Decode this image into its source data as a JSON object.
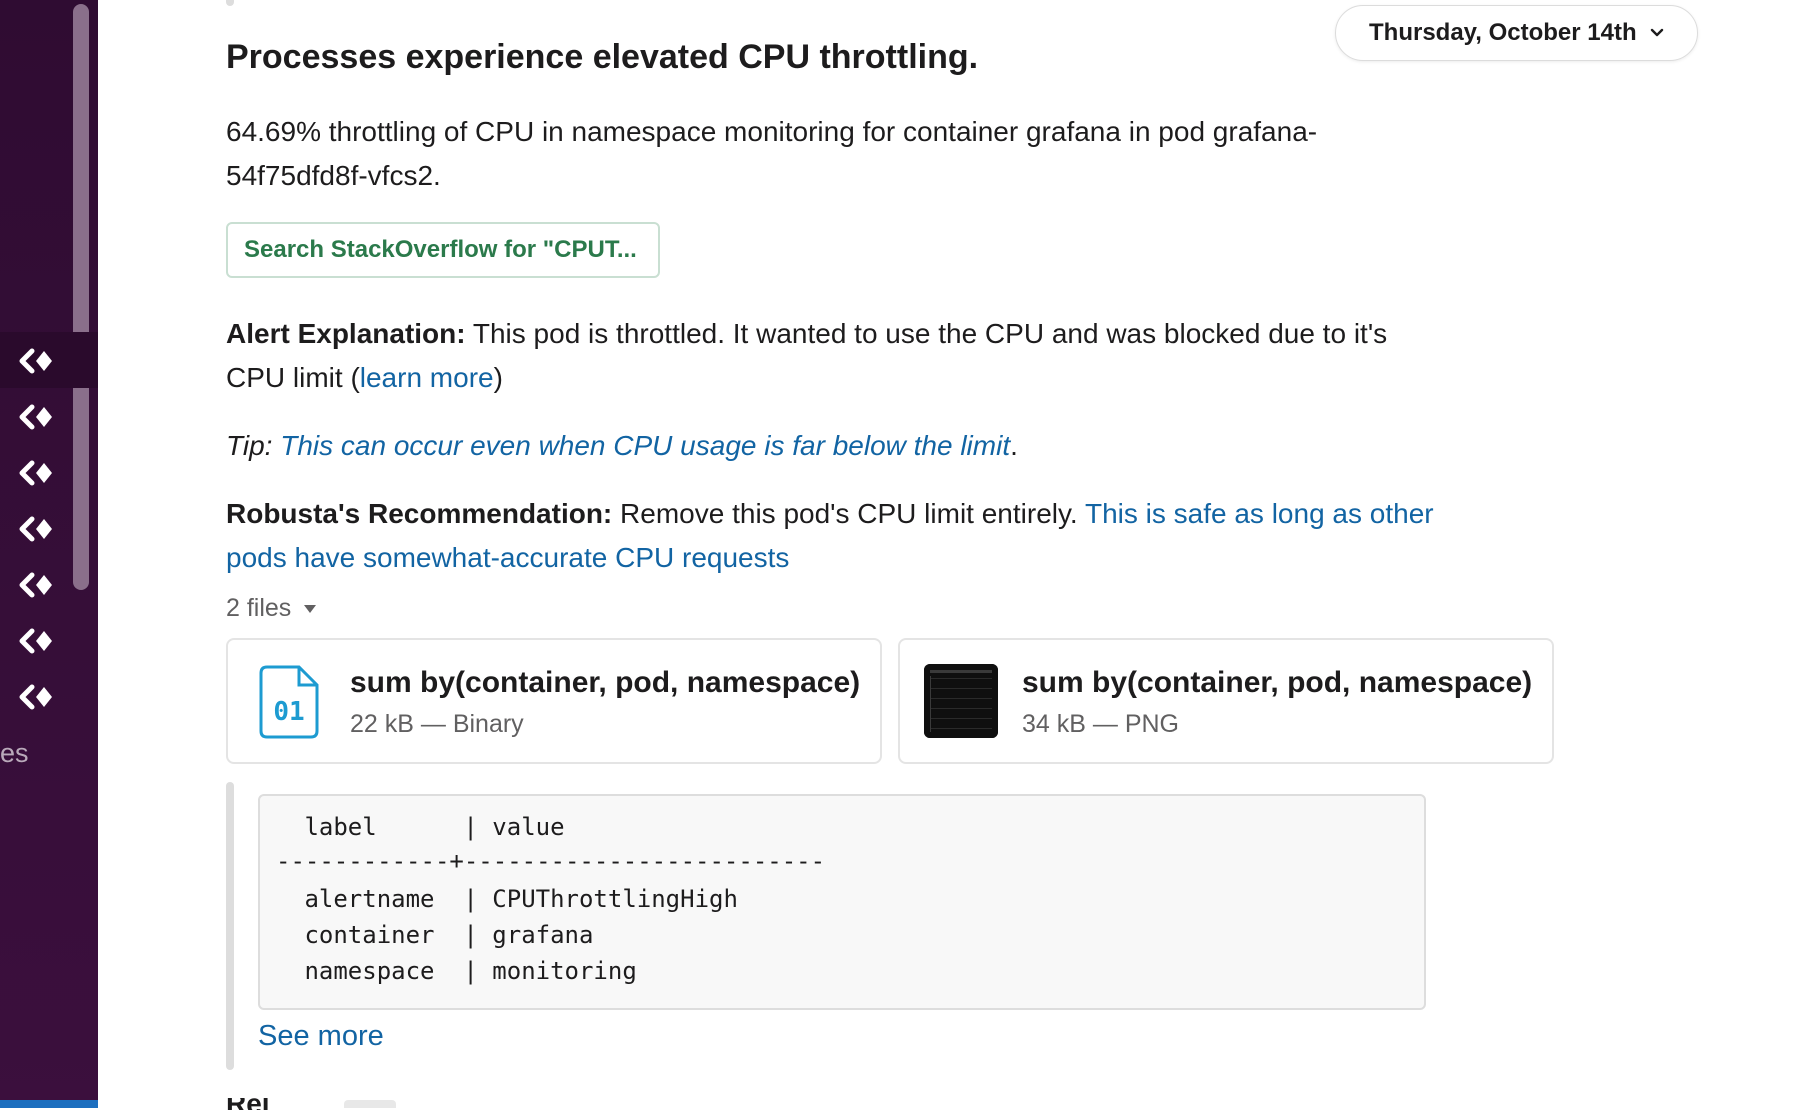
{
  "sidebar": {
    "partial_label": "es",
    "workspace_icon": "double-chevron-left-icon",
    "workspace_icon_count": 7
  },
  "header": {
    "date_label": "Thursday, October 14th"
  },
  "alert": {
    "title": "Processes experience elevated CPU throttling.",
    "description": "64.69% throttling of CPU in namespace monitoring for container grafana in pod grafana-54f75dfd8f-vfcs2.",
    "stackoverflow_button": "Search StackOverflow for \"CPUT...",
    "explanation": {
      "label": "Alert Explanation:",
      "text": " This pod is throttled. It wanted to use the CPU and was blocked due to it's CPU limit (",
      "link": "learn more",
      "suffix": ")"
    },
    "tip": {
      "label": "Tip:",
      "link": "This can occur even when CPU usage is far below the limit",
      "suffix": "."
    },
    "recommendation": {
      "label": "Robusta's Recommendation:",
      "text": " Remove this pod's CPU limit entirely. ",
      "link": "This is safe as long as other pods have somewhat-accurate CPU requests"
    }
  },
  "files": {
    "toggle_label": "2 files",
    "items": [
      {
        "name": "sum by(container, pod, namespace) (",
        "meta": "22 kB — Binary",
        "icon": "binary-file-icon"
      },
      {
        "name": "sum by(container, pod, namespace) (",
        "meta": "34 kB — PNG",
        "icon": "image-thumbnail"
      }
    ]
  },
  "labels_table": {
    "header": " label      | value",
    "separator": "------------+-------------------------",
    "rows": [
      " alertname  | CPUThrottlingHigh",
      " container  | grafana",
      " namespace  | monitoring"
    ]
  },
  "see_more": "See more",
  "next_section_partial": "Rel",
  "colors": {
    "sidebar": "#3f0e40",
    "link": "#1264a3",
    "button_text": "#2b7a4b"
  }
}
